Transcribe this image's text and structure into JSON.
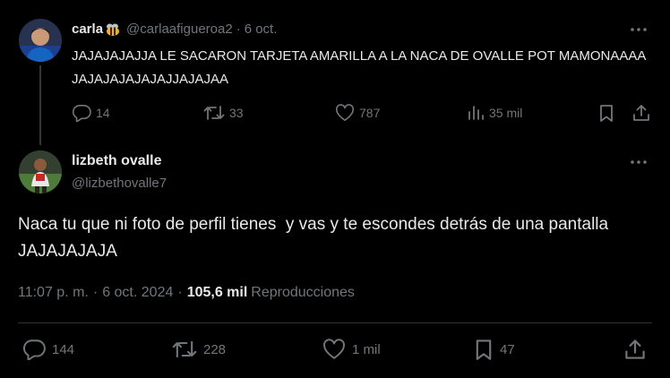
{
  "parent_tweet": {
    "display_name": "carla",
    "handle": "@carlaafigueroa2",
    "separator": "·",
    "date": "6 oct.",
    "text": "JAJAJAJAJJA LE SACARON TARJETA AMARILLA A LA NACA DE OVALLE POT MAMONAAAA JAJAJAJAJAJAJJAJAJAA",
    "replies": "14",
    "retweets": "33",
    "likes": "787",
    "views": "35 mil",
    "name_emoji_icon": "bee-icon"
  },
  "main_tweet": {
    "display_name": "lizbeth ovalle",
    "handle": "@lizbethovalle7",
    "text": "Naca tu que ni foto de perfil tienes  y vas y te escondes detrás de una pantalla JAJAJAJAJA",
    "time": "11:07 p. m.",
    "dot": "·",
    "date": "6 oct. 2024",
    "dot2": "·",
    "views_count": "105,6 mil",
    "views_label": "Reproducciones",
    "replies": "144",
    "retweets": "228",
    "likes": "1 mil",
    "bookmarks": "47"
  },
  "colors": {
    "background": "#000000",
    "text": "#e7e9ea",
    "muted": "#71767b",
    "divider": "#2f3336"
  }
}
